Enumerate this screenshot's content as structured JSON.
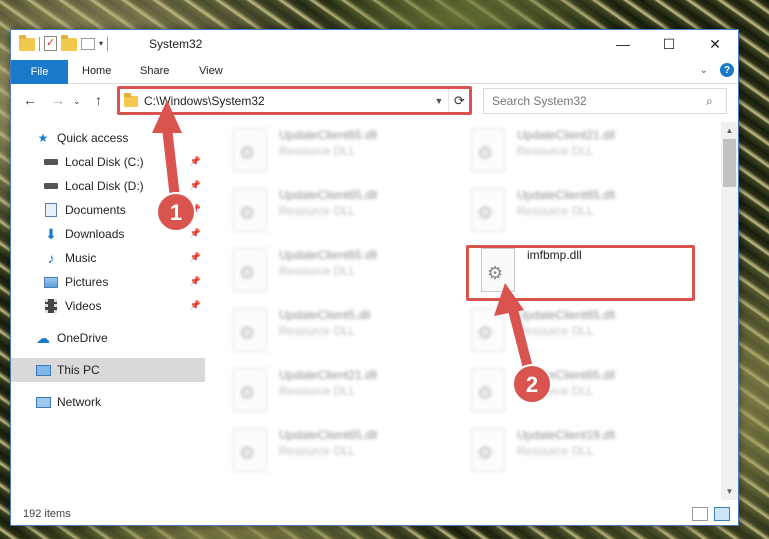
{
  "window": {
    "title": "System32",
    "controls": {
      "minimize": "—",
      "maximize": "☐",
      "close": "✕"
    }
  },
  "ribbon": {
    "file": "File",
    "tabs": [
      "Home",
      "Share",
      "View"
    ],
    "help": "?"
  },
  "navbar": {
    "address": "C:\\Windows\\System32",
    "search_placeholder": "Search System32"
  },
  "sidebar": {
    "quick_access": "Quick access",
    "items": [
      {
        "label": "Local Disk (C:)",
        "icon": "drive-icon",
        "pinned": true
      },
      {
        "label": "Local Disk (D:)",
        "icon": "drive-icon",
        "pinned": true
      },
      {
        "label": "Documents",
        "icon": "documents-icon",
        "pinned": true
      },
      {
        "label": "Downloads",
        "icon": "downloads-icon",
        "pinned": true
      },
      {
        "label": "Music",
        "icon": "music-icon",
        "pinned": true
      },
      {
        "label": "Pictures",
        "icon": "pictures-icon",
        "pinned": true
      },
      {
        "label": "Videos",
        "icon": "videos-icon",
        "pinned": true
      }
    ],
    "onedrive": "OneDrive",
    "this_pc": "This PC",
    "network": "Network"
  },
  "files": {
    "left_column": [
      {
        "name": "UpdateClient65.dll",
        "type": "Resource DLL"
      },
      {
        "name": "UpdateClient65.dll",
        "type": "Resource DLL"
      },
      {
        "name": "UpdateClient65.dll",
        "type": "Resource DLL"
      },
      {
        "name": "UpdateClient5.dll",
        "type": "Resource DLL"
      },
      {
        "name": "UpdateClient21.dll",
        "type": "Resource DLL"
      },
      {
        "name": "UpdateClient65.dll",
        "type": "Resource DLL"
      }
    ],
    "right_column": [
      {
        "name": "UpdateClient21.dll",
        "type": "Resource DLL"
      },
      {
        "name": "UpdateClient65.dll",
        "type": "Resource DLL"
      },
      {
        "name": "imfbmp.dll",
        "type": ""
      },
      {
        "name": "UpdateClient65.dll",
        "type": "Resource DLL"
      },
      {
        "name": "UpdateClient65.dll",
        "type": "Resource DLL"
      },
      {
        "name": "UpdateClient19.dll",
        "type": "Resource DLL"
      }
    ]
  },
  "status": {
    "items_count": "192 items"
  },
  "annotations": {
    "step1": "1",
    "step2": "2",
    "color": "#d9534f"
  }
}
